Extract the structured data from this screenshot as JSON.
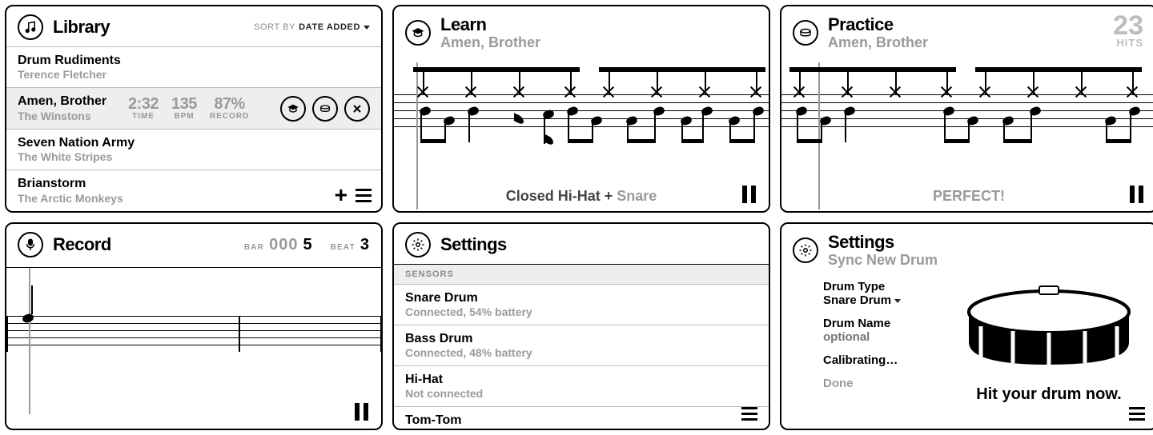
{
  "library": {
    "title": "Library",
    "sort": {
      "label": "SORT BY",
      "value": "DATE ADDED"
    },
    "tracks": [
      {
        "title": "Drum Rudiments",
        "artist": "Terence Fletcher"
      },
      {
        "title": "Amen, Brother",
        "artist": "The Winstons",
        "time": {
          "value": "2:32",
          "label": "TIME"
        },
        "bpm": {
          "value": "135",
          "label": "BPM"
        },
        "rec": {
          "value": "87%",
          "label": "RECORD"
        }
      },
      {
        "title": "Seven Nation Army",
        "artist": "The White Stripes"
      },
      {
        "title": "Brianstorm",
        "artist": "The Arctic Monkeys"
      }
    ]
  },
  "learn": {
    "title": "Learn",
    "subtitle": "Amen, Brother",
    "current": {
      "a": "Closed Hi-Hat",
      "plus": "+",
      "b": "Snare"
    }
  },
  "practice": {
    "title": "Practice",
    "subtitle": "Amen, Brother",
    "hits": {
      "value": "23",
      "label": "HITS"
    },
    "status": "PERFECT!"
  },
  "record": {
    "title": "Record",
    "bar": {
      "label": "BAR",
      "value_dim": "000",
      "value_bright": "5"
    },
    "beat": {
      "label": "BEAT",
      "value": "3"
    }
  },
  "settings_list": {
    "title": "Settings",
    "section": "SENSORS",
    "items": [
      {
        "name": "Snare Drum",
        "status": "Connected, 54% battery"
      },
      {
        "name": "Bass Drum",
        "status": "Connected, 48% battery"
      },
      {
        "name": "Hi-Hat",
        "status": "Not connected"
      },
      {
        "name": "Tom-Tom",
        "status": ""
      }
    ]
  },
  "settings_sync": {
    "title": "Settings",
    "subtitle": "Sync New Drum",
    "type": {
      "label": "Drum Type",
      "value": "Snare Drum"
    },
    "name": {
      "label": "Drum Name",
      "placeholder": "optional"
    },
    "calibrating": "Calibrating…",
    "done": "Done",
    "hit_prompt": "Hit your drum now."
  }
}
